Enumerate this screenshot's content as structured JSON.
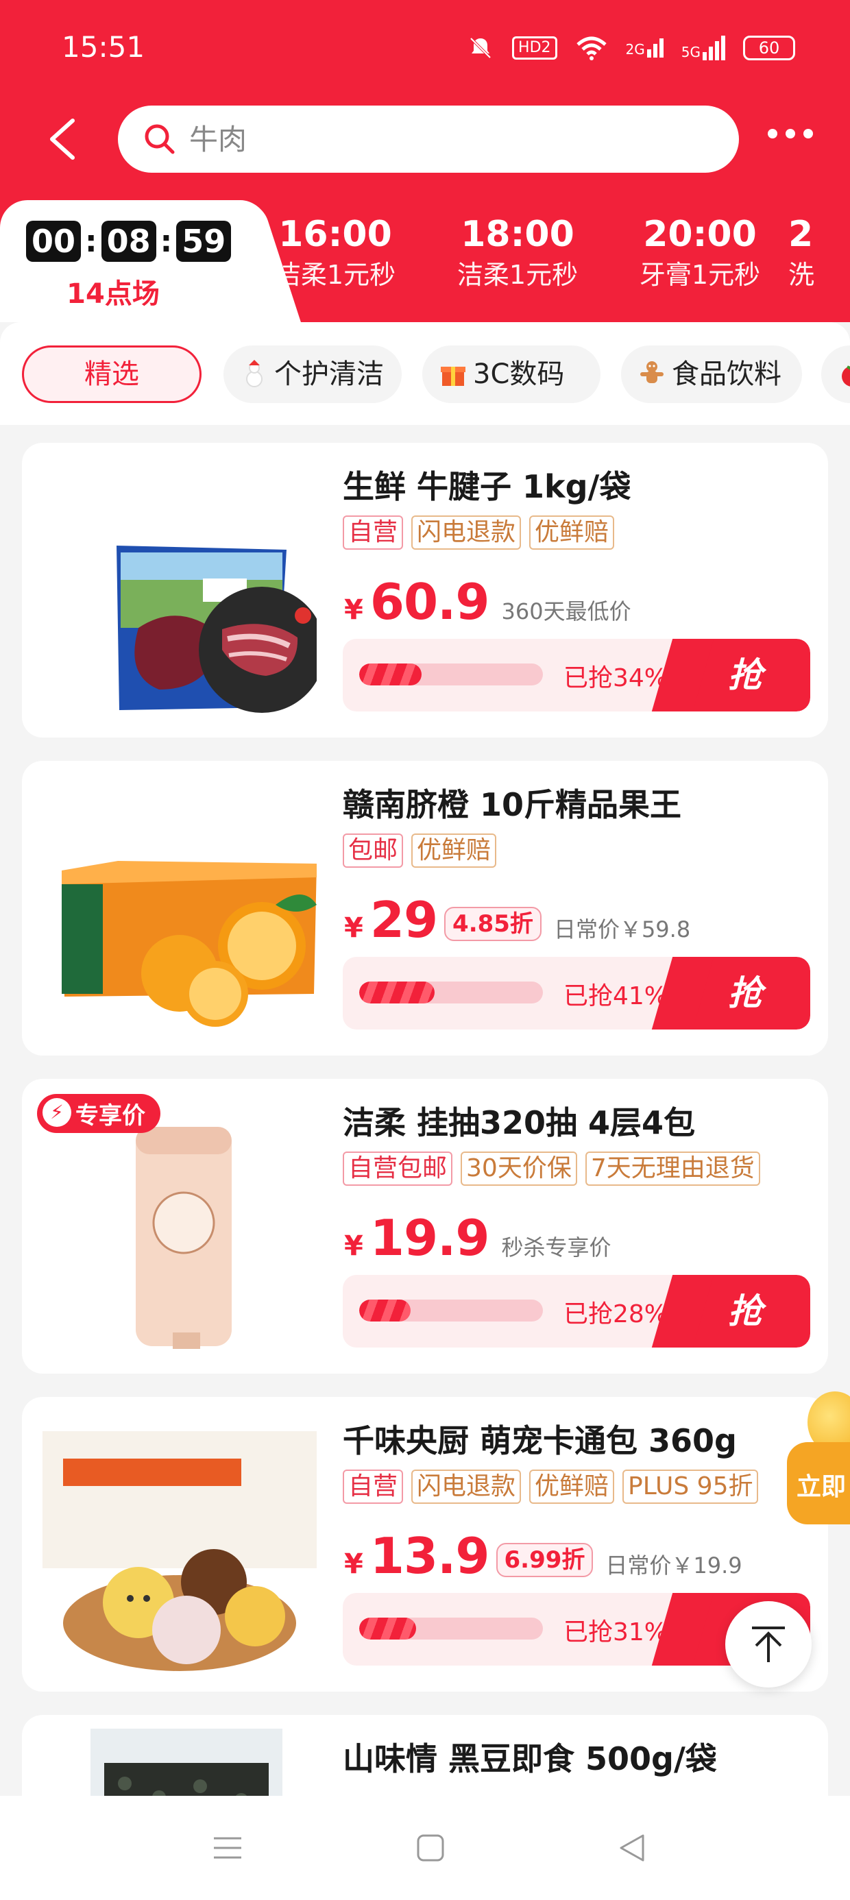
{
  "status_bar": {
    "time": "15:51",
    "hd_label": "HD2",
    "net_a": "2G",
    "net_b": "5G",
    "battery": "60"
  },
  "search": {
    "placeholder": "牛肉"
  },
  "time_tabs": {
    "active": {
      "countdown": [
        "00",
        "08",
        "59"
      ],
      "label": "14点场"
    },
    "items": [
      {
        "time": "16:00",
        "subtitle": "洁柔1元秒"
      },
      {
        "time": "18:00",
        "subtitle": "洁柔1元秒"
      },
      {
        "time": "20:00",
        "subtitle": "牙膏1元秒"
      },
      {
        "time": "2",
        "subtitle": "洗"
      }
    ]
  },
  "categories": [
    {
      "label": "精选",
      "icon": "none",
      "selected": true
    },
    {
      "label": "个护清洁",
      "icon": "snowman-icon"
    },
    {
      "label": "3C数码",
      "icon": "gift-icon"
    },
    {
      "label": "食品饮料",
      "icon": "gingerbread-icon"
    }
  ],
  "products": [
    {
      "title": "生鲜 牛腱子 1kg/袋",
      "tags": [
        {
          "text": "自营",
          "style": "r"
        },
        {
          "text": "闪电退款",
          "style": "o"
        },
        {
          "text": "优鲜赔",
          "style": "o"
        }
      ],
      "currency": "¥",
      "price": "60.9",
      "discount": "",
      "note": "360天最低价",
      "progress": 0.34,
      "progress_label": "已抢34%",
      "grab_label": "抢",
      "badge": "",
      "image": "beef-shank-package-image"
    },
    {
      "title": "赣南脐橙 10斤精品果王",
      "tags": [
        {
          "text": "包邮",
          "style": "r"
        },
        {
          "text": "优鲜赔",
          "style": "o"
        }
      ],
      "currency": "¥",
      "price": "29",
      "discount": "4.85折",
      "note": "日常价￥59.8",
      "progress": 0.41,
      "progress_label": "已抢41%",
      "grab_label": "抢",
      "badge": "",
      "image": "navel-orange-box-image"
    },
    {
      "title": "洁柔 挂抽320抽 4层4包",
      "tags": [
        {
          "text": "自营包邮",
          "style": "r"
        },
        {
          "text": "30天价保",
          "style": "o"
        },
        {
          "text": "7天无理由退货",
          "style": "o"
        }
      ],
      "currency": "¥",
      "price": "19.9",
      "discount": "",
      "note": "秒杀专享价",
      "progress": 0.28,
      "progress_label": "已抢28%",
      "grab_label": "抢",
      "badge": "专享价",
      "image": "tissue-pack-image"
    },
    {
      "title": "千味央厨 萌宠卡通包 360g",
      "tags": [
        {
          "text": "自营",
          "style": "r"
        },
        {
          "text": "闪电退款",
          "style": "o"
        },
        {
          "text": "优鲜赔",
          "style": "o"
        },
        {
          "text": "PLUS 95折",
          "style": "o"
        }
      ],
      "currency": "¥",
      "price": "13.9",
      "discount": "6.99折",
      "note": "日常价￥19.9",
      "progress": 0.31,
      "progress_label": "已抢31%",
      "grab_label": "抢",
      "badge": "",
      "image": "cartoon-bun-image"
    },
    {
      "title": "山味情 黑豆即食 500g/袋",
      "tags": [],
      "currency": "",
      "price": "",
      "discount": "",
      "note": "",
      "progress": 0,
      "progress_label": "",
      "grab_label": "",
      "badge": "",
      "image": "black-bean-bag-image"
    }
  ],
  "floating": {
    "promo_label": "立即"
  },
  "colors": {
    "brand_red": "#f2213a",
    "tag_orange": "#c97b3a"
  }
}
